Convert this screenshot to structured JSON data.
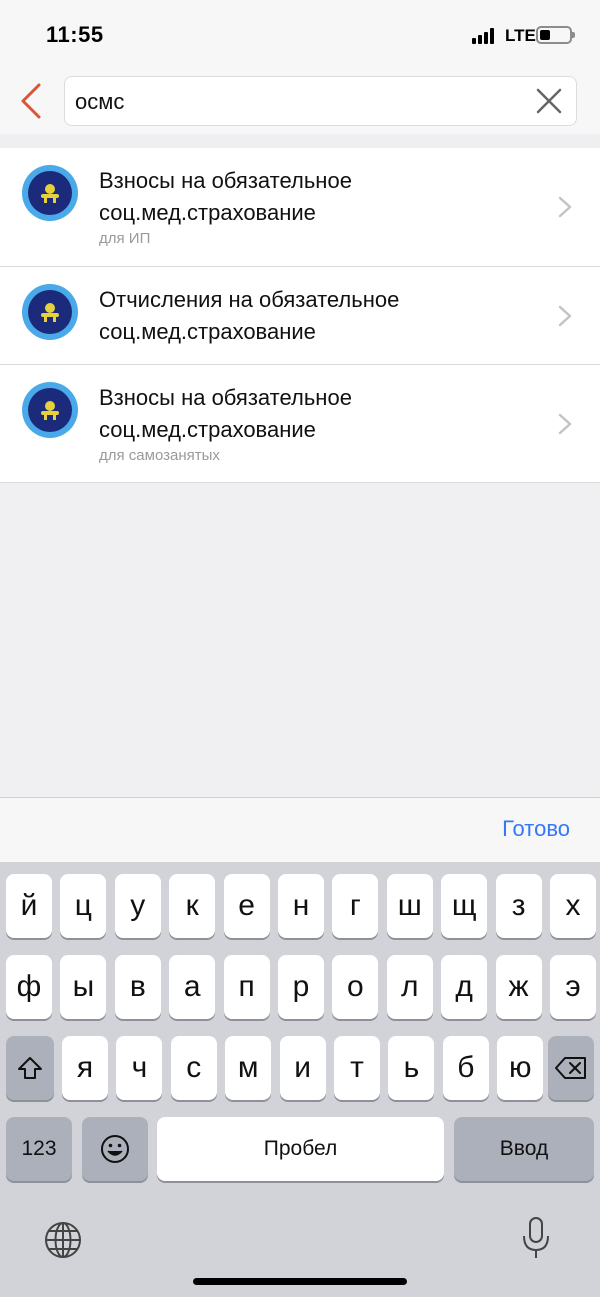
{
  "status": {
    "time": "11:55",
    "network": "LTE"
  },
  "search": {
    "query": "осмс"
  },
  "results": [
    {
      "title": "Взносы на обязательное соц.мед.страхование",
      "subtitle": "для ИП"
    },
    {
      "title": "Отчисления на обязательное соц.мед.страхование",
      "subtitle": ""
    },
    {
      "title": "Взносы на обязательное соц.мед.страхование",
      "subtitle": "для самозанятых"
    }
  ],
  "toolbar": {
    "done_label": "Готово"
  },
  "keyboard": {
    "row1": [
      "й",
      "ц",
      "у",
      "к",
      "е",
      "н",
      "г",
      "ш",
      "щ",
      "з",
      "х"
    ],
    "row2": [
      "ф",
      "ы",
      "в",
      "а",
      "п",
      "р",
      "о",
      "л",
      "д",
      "ж",
      "э"
    ],
    "row3": [
      "я",
      "ч",
      "с",
      "м",
      "и",
      "т",
      "ь",
      "б",
      "ю"
    ],
    "numbers_label": "123",
    "space_label": "Пробел",
    "enter_label": "Ввод"
  },
  "colors": {
    "accent": "#3478f6",
    "back": "#d9553a",
    "icon_outer": "#4aa9e8",
    "icon_inner": "#1b2a7a"
  }
}
